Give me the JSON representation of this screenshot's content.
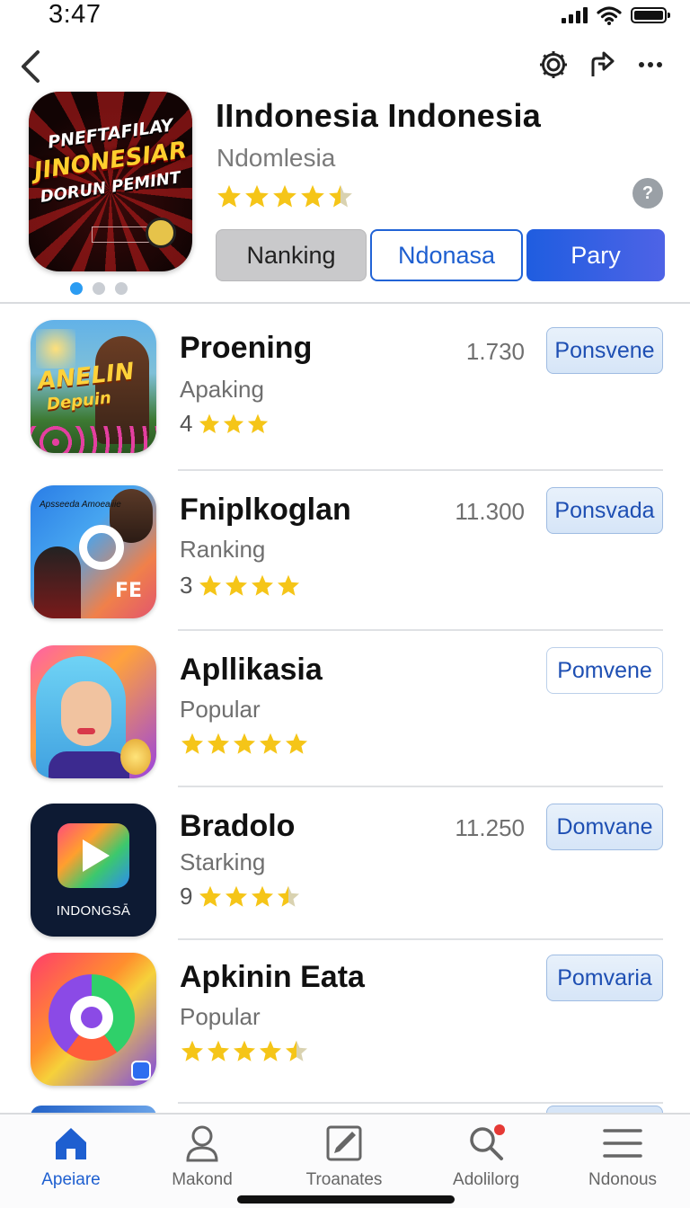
{
  "status_bar": {
    "time": "3:47",
    "battery_level": 1.0,
    "icons": [
      "signal-icon",
      "wifi-icon",
      "battery-icon"
    ]
  },
  "nav": {
    "back_icon": "chevron-left-icon",
    "actions": [
      "gear-icon",
      "share-icon",
      "more-icon"
    ]
  },
  "hero": {
    "icon_text": [
      "PNEFTAFILAY",
      "JINONESIAR",
      "DORUN PEMINT"
    ],
    "title": "IIndonesia Indonesia",
    "subtitle": "Ndomlesia",
    "rating_stars": 4.5,
    "help_icon": "question-circle-icon",
    "help_glyph": "?",
    "page_dots": 3,
    "active_dot": 0,
    "segments": [
      {
        "label": "Nanking",
        "state": "grey"
      },
      {
        "label": "Ndonasa",
        "state": "outline"
      },
      {
        "label": "Pary",
        "state": "filled"
      }
    ]
  },
  "apps": [
    {
      "name": "Proening",
      "category": "Apaking",
      "rating_num": "4",
      "stars": 3.5,
      "count": "1.730",
      "button": "Ponsvene",
      "icon_text": [
        "ANELIN",
        "Depuin"
      ]
    },
    {
      "name": "Fniplkoglan",
      "category": "Ranking",
      "rating_num": "3",
      "stars": 4.5,
      "count": "11.300",
      "button": "Ponsvada",
      "icon_text": [
        "FE",
        "Apsseeda Amoeaiiie"
      ]
    },
    {
      "name": "Apllikasia",
      "category": "Popular",
      "rating_num": "",
      "stars": 5,
      "count": "",
      "button": "Pomvene",
      "icon_text": []
    },
    {
      "name": "Bradolo",
      "category": "Starking",
      "rating_num": "9",
      "stars": 3.5,
      "count": "11.250",
      "button": "Domvane",
      "icon_text": [
        "INDONGSĀ"
      ]
    },
    {
      "name": "Apkinin Eata",
      "category": "Popular",
      "rating_num": "",
      "stars": 4.5,
      "count": "",
      "button": "Pomvaria",
      "icon_text": []
    }
  ],
  "tabs": [
    {
      "label": "Apeiare",
      "icon": "home-icon",
      "active": true
    },
    {
      "label": "Makond",
      "icon": "person-icon",
      "active": false
    },
    {
      "label": "Troanates",
      "icon": "edit-square-icon",
      "active": false
    },
    {
      "label": "Adolilorg",
      "icon": "search-icon",
      "active": false
    },
    {
      "label": "Ndonous",
      "icon": "menu-icon",
      "active": false
    }
  ],
  "colors": {
    "accent": "#2163d6",
    "star": "#f5c518",
    "star_empty": "#d9d2b0",
    "notification_dot": "#e53935"
  }
}
